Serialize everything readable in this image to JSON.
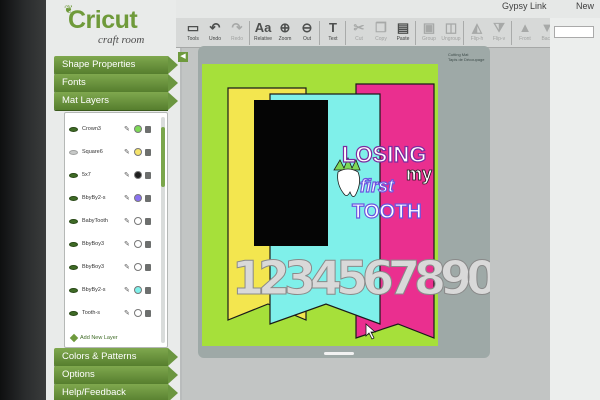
{
  "app": {
    "logo_title": "Cricut",
    "logo_subtitle": "craft room"
  },
  "header": {
    "user_name": "Gypsy Link",
    "new_label": "New"
  },
  "sidebar": {
    "tabs": [
      {
        "label": "Shape Properties"
      },
      {
        "label": "Fonts"
      },
      {
        "label": "Mat Layers"
      }
    ],
    "bottom_tabs": [
      {
        "label": "Colors & Patterns"
      },
      {
        "label": "Options"
      },
      {
        "label": "Help/Feedback"
      }
    ],
    "layers": [
      {
        "name": "Crown3",
        "visible": true,
        "color": "#7ed957"
      },
      {
        "name": "Square6",
        "visible": false,
        "color": "#f5e36b"
      },
      {
        "name": "5x7",
        "visible": true,
        "color": "#1e1e1e"
      },
      {
        "name": "BbyBy2-s",
        "visible": true,
        "color": "#8a72f0"
      },
      {
        "name": "BabyTooth",
        "visible": true,
        "color": "#ffffff"
      },
      {
        "name": "BbyBoy3",
        "visible": true,
        "color": "#ffffff"
      },
      {
        "name": "BbyBoy3",
        "visible": true,
        "color": "#ffffff"
      },
      {
        "name": "BbyBy2-s",
        "visible": true,
        "color": "#7ff0ea"
      },
      {
        "name": "Tooth-s",
        "visible": true,
        "color": "#ffffff"
      }
    ],
    "add_layer_label": "Add New Layer"
  },
  "toolbar": {
    "buttons": [
      {
        "label": "Tools",
        "icon": "tools-icon",
        "glyph": "▭"
      },
      {
        "label": "Undo",
        "icon": "undo-icon",
        "glyph": "↶"
      },
      {
        "label": "Redo",
        "icon": "redo-icon",
        "glyph": "↷"
      },
      {
        "label": "Relative",
        "icon": "font-aa-icon",
        "glyph": "Aa"
      },
      {
        "label": "Zoom",
        "icon": "zoom-in-icon",
        "glyph": "⊕"
      },
      {
        "label": "Out",
        "icon": "zoom-out-icon",
        "glyph": "⊖"
      },
      {
        "label": "Text",
        "icon": "text-icon",
        "glyph": "T"
      },
      {
        "label": "Cut",
        "icon": "cut-icon",
        "glyph": "✂"
      },
      {
        "label": "Copy",
        "icon": "copy-icon",
        "glyph": "❐"
      },
      {
        "label": "Paste",
        "icon": "paste-icon",
        "glyph": "▤"
      },
      {
        "label": "Group",
        "icon": "group-icon",
        "glyph": "▣"
      },
      {
        "label": "Ungroup",
        "icon": "ungroup-icon",
        "glyph": "◫"
      },
      {
        "label": "Flip-h",
        "icon": "flip-horizontal-icon",
        "glyph": "◭"
      },
      {
        "label": "Flip-v",
        "icon": "flip-vertical-icon",
        "glyph": "⧩"
      },
      {
        "label": "Front",
        "icon": "bring-front-icon",
        "glyph": "▲"
      },
      {
        "label": "Back",
        "icon": "send-back-icon",
        "glyph": "▼"
      },
      {
        "label": "Delete",
        "icon": "delete-icon",
        "glyph": "✖"
      }
    ]
  },
  "mat": {
    "label_line1": "Cutting Mat",
    "label_line2": "Tapis de Découpage"
  },
  "artwork": {
    "title_line1": "LOSING",
    "title_line2": "my",
    "title_line3": "first",
    "title_line4": "TOOTH",
    "numbers": "1234567890",
    "colors": {
      "mat_green": "#a6e03a",
      "yellow": "#f3e64f",
      "cyan": "#7ff0ea",
      "magenta": "#ea2f8f",
      "photo_block": "#050505",
      "purple": "#6a55e0"
    }
  }
}
